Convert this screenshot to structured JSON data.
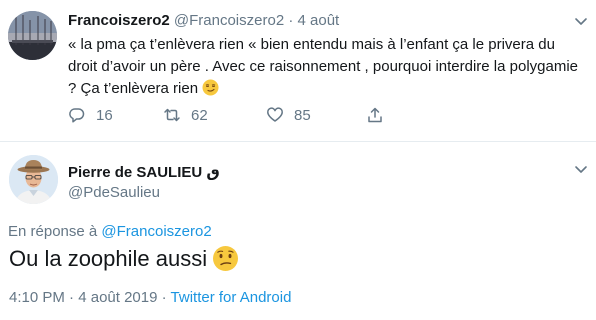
{
  "parent_tweet": {
    "author_name": "Francoiszero2",
    "handle": "@Francoiszero2",
    "separator": "·",
    "date": "4 août",
    "text": "« la pma ça t’enlèvera rien «  bien entendu mais à l’enfant ça le privera du droit d’avoir un père . Avec ce raisonnement , pourquoi interdire la polygamie ? Ça t’enlèvera  rien",
    "emoji": "smirking-face",
    "replies": "16",
    "retweets": "62",
    "likes": "85"
  },
  "main_tweet": {
    "author_name": "Pierre de SAULIEU",
    "name_badge": "ٯ",
    "handle": "@PdeSaulieu",
    "reply_prefix": "En réponse à",
    "reply_to": "@Francoiszero2",
    "text": "Ou la zoophile aussi",
    "emoji": "confused-face",
    "time": "4:10 PM",
    "date": "4 août 2019",
    "separator": "·",
    "source": "Twitter for Android"
  },
  "colors": {
    "text": "#14171a",
    "secondary": "#657786",
    "link": "#1b95e0",
    "divider": "#e6ecf0"
  }
}
